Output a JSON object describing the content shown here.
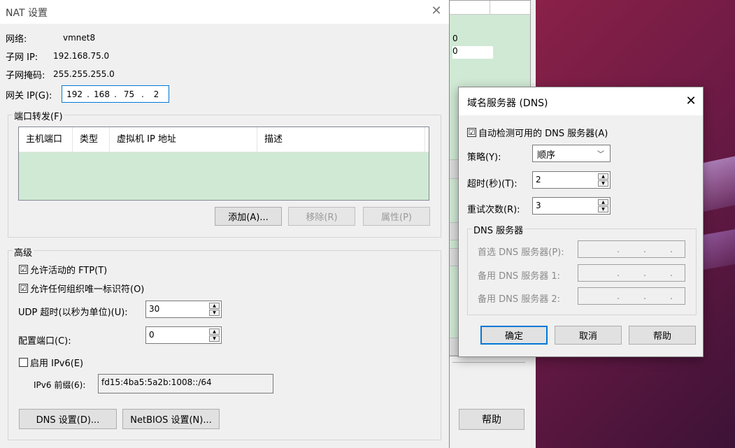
{
  "nat": {
    "title": "NAT 设置",
    "close": "✕",
    "network_label": "网络:",
    "network_value": "vmnet8",
    "subnet_ip_label": "子网 IP:",
    "subnet_ip_value": "192.168.75.0",
    "subnet_mask_label": "子网掩码:",
    "subnet_mask_value": "255.255.255.0",
    "gateway_label": "网关 IP(G):",
    "gateway_octets": [
      "192",
      "168",
      "75",
      "2"
    ],
    "port_forwarding": {
      "title": "端口转发(F)",
      "columns": [
        "主机端口",
        "类型",
        "虚拟机 IP 地址",
        "描述"
      ],
      "add_label": "添加(A)...",
      "remove_label": "移除(R)",
      "properties_label": "属性(P)"
    },
    "advanced": {
      "title": "高级",
      "allow_ftp_label": "允许活动的 FTP(T)",
      "allow_ftp_checked": "☑",
      "allow_uid_label": "允许任何组织唯一标识符(O)",
      "allow_uid_checked": "☑",
      "udp_timeout_label": "UDP 超时(以秒为单位)(U):",
      "udp_timeout_value": "30",
      "config_port_label": "配置端口(C):",
      "config_port_value": "0",
      "enable_ipv6_label": "启用 IPv6(E)",
      "ipv6_prefix_label": "IPv6 前缀(6):",
      "ipv6_prefix_value": "fd15:4ba5:5a2b:1008::/64"
    },
    "dns_settings_label": "DNS 设置(D)...",
    "netbios_settings_label": "NetBIOS 设置(N)..."
  },
  "background_window": {
    "value1": "0",
    "value2": "0",
    "help_label": "帮助"
  },
  "dns": {
    "title": "域名服务器 (DNS)",
    "close": "✕",
    "auto_detect_label": "自动检测可用的 DNS 服务器(A)",
    "auto_detect_checked": "☑",
    "policy_label": "策略(Y):",
    "policy_value": "顺序",
    "timeout_label": "超时(秒)(T):",
    "timeout_value": "2",
    "retries_label": "重试次数(R):",
    "retries_value": "3",
    "servers_group_title": "DNS 服务器",
    "preferred_label": "首选 DNS 服务器(P):",
    "alternate1_label": "备用 DNS 服务器 1:",
    "alternate2_label": "备用 DNS 服务器 2:",
    "ok_label": "确定",
    "cancel_label": "取消",
    "help_label": "帮助"
  }
}
